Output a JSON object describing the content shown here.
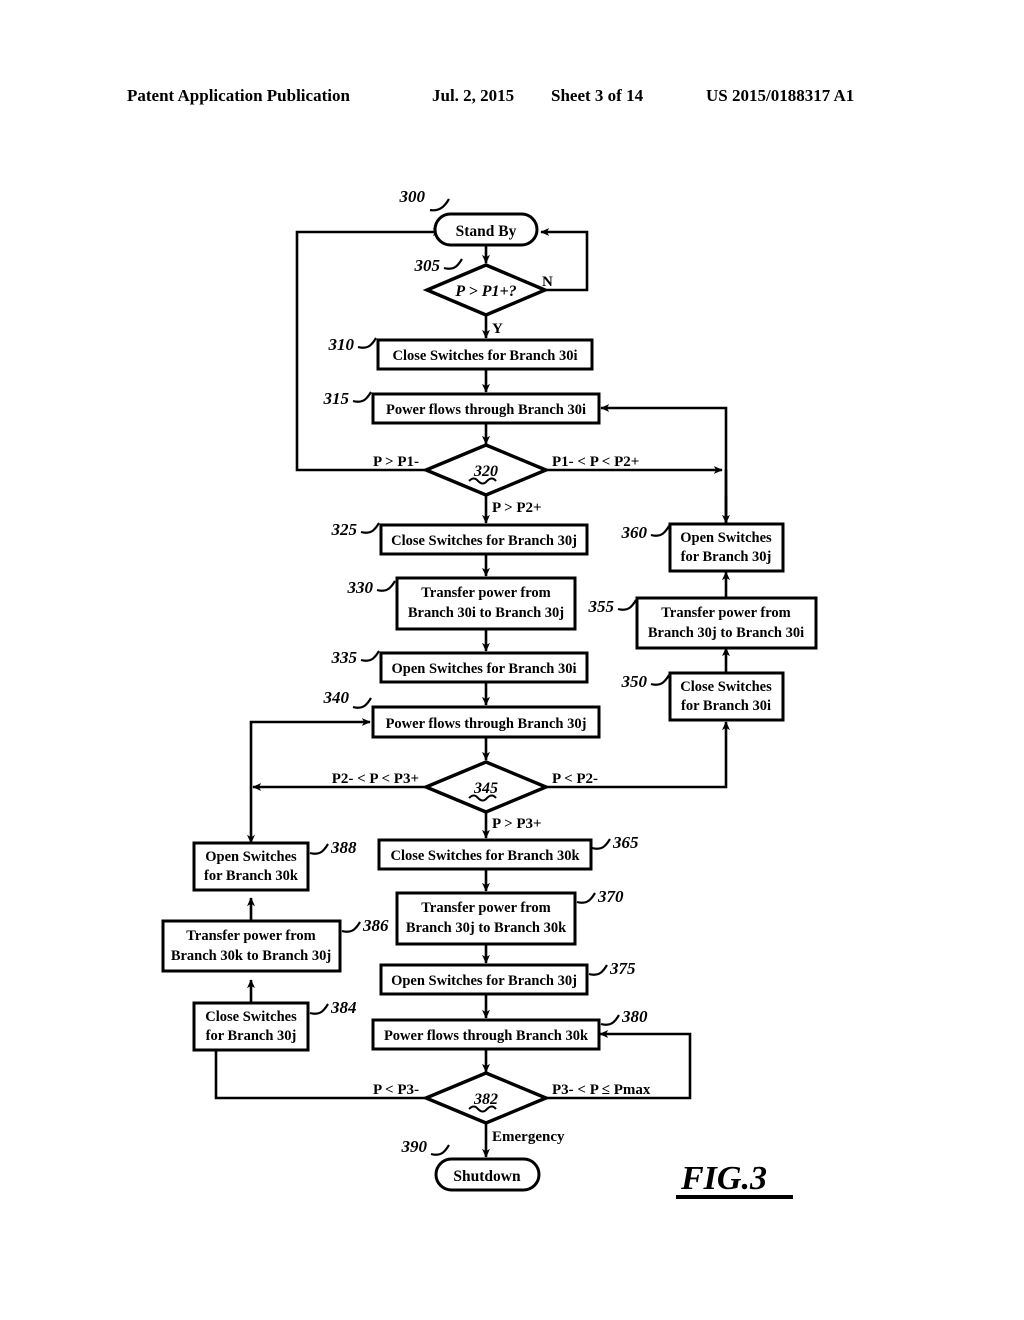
{
  "header": {
    "publication": "Patent Application Publication",
    "date": "Jul. 2, 2015",
    "sheet": "Sheet 3 of 14",
    "patent_number": "US 2015/0188317 A1"
  },
  "figure": {
    "caption": "FIG.3"
  },
  "nodes": {
    "n300": {
      "ref": "300",
      "label": "Stand By",
      "shape": "terminator"
    },
    "n305": {
      "ref": "305",
      "label": "P > P1+?",
      "shape": "decision"
    },
    "n310": {
      "ref": "310",
      "label": "Close Switches for Branch 30i",
      "shape": "process"
    },
    "n315": {
      "ref": "315",
      "label": "Power flows through Branch 30i",
      "shape": "process"
    },
    "n320": {
      "ref": "320",
      "label": "320",
      "shape": "decision"
    },
    "n325": {
      "ref": "325",
      "label": "Close Switches for Branch 30j",
      "shape": "process"
    },
    "n330": {
      "ref": "330",
      "line1": "Transfer power from",
      "line2": "Branch 30i to Branch 30j",
      "shape": "process"
    },
    "n335": {
      "ref": "335",
      "label": "Open Switches for Branch 30i",
      "shape": "process"
    },
    "n340": {
      "ref": "340",
      "label": "Power flows through Branch 30j",
      "shape": "process"
    },
    "n345": {
      "ref": "345",
      "label": "345",
      "shape": "decision"
    },
    "n350": {
      "ref": "350",
      "line1": "Close Switches",
      "line2": "for Branch 30i",
      "shape": "process"
    },
    "n355": {
      "ref": "355",
      "line1": "Transfer power from",
      "line2": "Branch 30j to Branch 30i",
      "shape": "process"
    },
    "n360": {
      "ref": "360",
      "line1": "Open Switches",
      "line2": "for Branch 30j",
      "shape": "process"
    },
    "n365": {
      "ref": "365",
      "label": "Close Switches for Branch 30k",
      "shape": "process"
    },
    "n370": {
      "ref": "370",
      "line1": "Transfer power from",
      "line2": "Branch 30j to Branch 30k",
      "shape": "process"
    },
    "n375": {
      "ref": "375",
      "label": "Open Switches for Branch 30j",
      "shape": "process"
    },
    "n380": {
      "ref": "380",
      "label": "Power flows through Branch 30k",
      "shape": "process"
    },
    "n382": {
      "ref": "382",
      "label": "382",
      "shape": "decision"
    },
    "n384": {
      "ref": "384",
      "line1": "Close Switches",
      "line2": "for Branch 30j",
      "shape": "process"
    },
    "n386": {
      "ref": "386",
      "line1": "Transfer power from",
      "line2": "Branch 30k to Branch 30j",
      "shape": "process"
    },
    "n388": {
      "ref": "388",
      "line1": "Open Switches",
      "line2": "for Branch 30k",
      "shape": "process"
    },
    "n390": {
      "ref": "390",
      "label": "Shutdown",
      "shape": "terminator"
    }
  },
  "edge_labels": {
    "d305_no": "N",
    "d305_yes": "Y",
    "d320_left": "P > P1-",
    "d320_right": "P1- < P < P2+",
    "d320_down": "P > P2+",
    "d345_left": "P2- < P < P3+",
    "d345_right": "P < P2-",
    "d345_down": "P > P3+",
    "d382_left": "P < P3-",
    "d382_right": "P3- < P ≤ Pmax",
    "d382_down": "Emergency"
  }
}
